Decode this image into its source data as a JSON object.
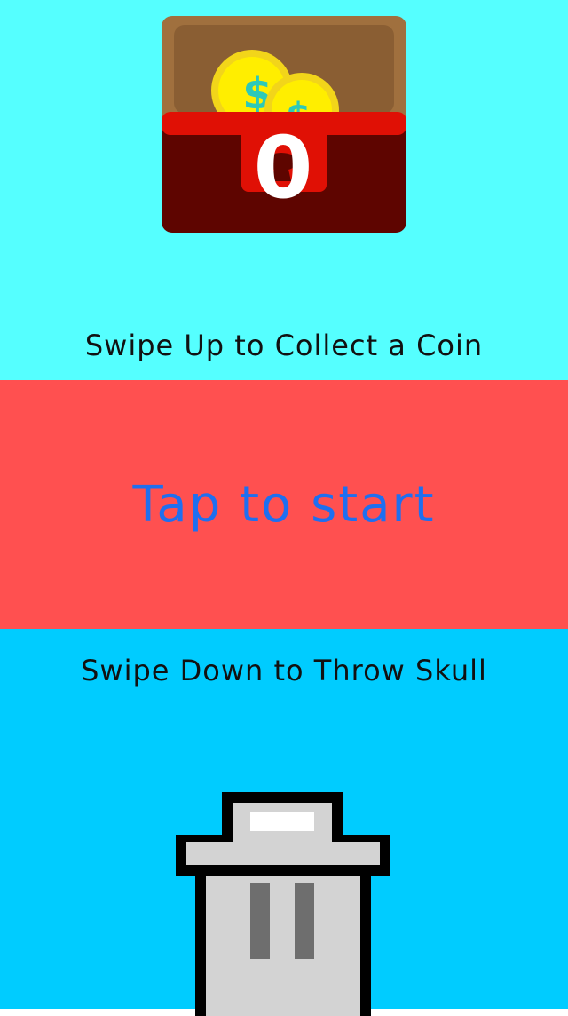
{
  "colors": {
    "top_bg": "#55FFFF",
    "middle_bg": "#FF5050",
    "bottom_bg": "#00CCFF",
    "start_text": "#1E6FF0",
    "hint_text": "#111111"
  },
  "chest": {
    "icon": "treasure-chest-icon",
    "coin_count": "0",
    "coin_symbol": "$"
  },
  "instructions": {
    "swipe_up": "Swipe Up to Collect a Coin",
    "tap": "Tap to start",
    "swipe_down": "Swipe Down to Throw Skull"
  },
  "trash": {
    "icon": "trash-can-icon"
  }
}
